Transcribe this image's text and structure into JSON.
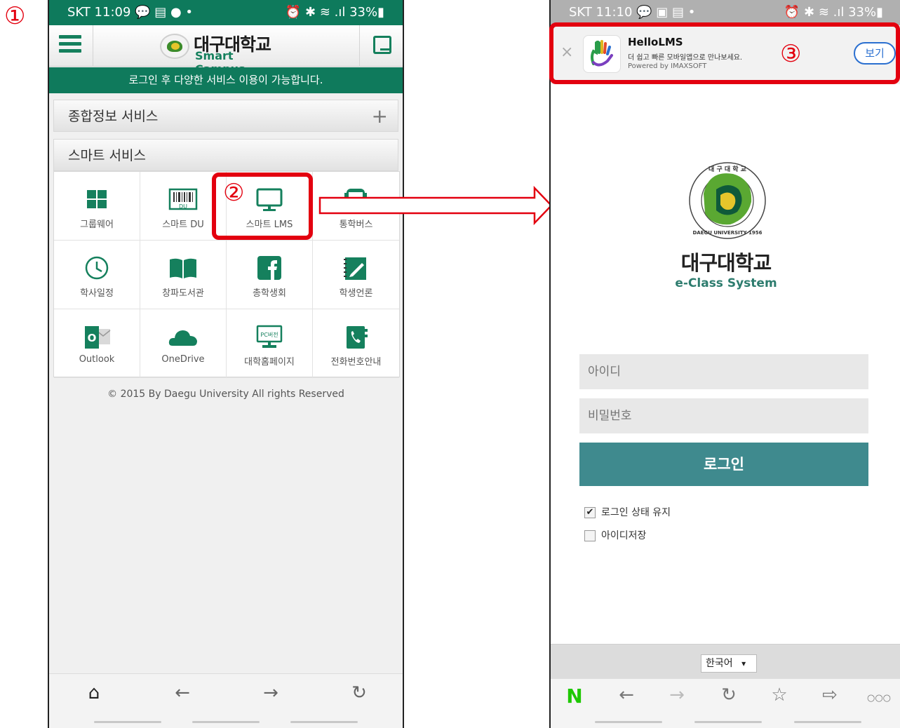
{
  "annotations": {
    "n1": "①",
    "n2": "②",
    "n3": "③"
  },
  "phone1": {
    "status": {
      "left": "SKT 11:09 💬 ▤ ● •",
      "right": "⏰ ✱ ≋ .ıl 33%▮"
    },
    "header": {
      "logo_ko": "대구대학교",
      "logo_en": "Smart Campus"
    },
    "banner": "로그인 후 다양한 서비스 이용이 가능합니다.",
    "section1": "종합정보 서비스",
    "section1_plus": "+",
    "section2": "스마트 서비스",
    "grid": [
      {
        "label": "그룹웨어",
        "icon": "groupware-icon"
      },
      {
        "label": "스마트 DU",
        "icon": "barcode-icon"
      },
      {
        "label": "스마트 LMS",
        "icon": "monitor-icon"
      },
      {
        "label": "통학버스",
        "icon": "bus-icon"
      },
      {
        "label": "학사일정",
        "icon": "clock-icon"
      },
      {
        "label": "창파도서관",
        "icon": "book-icon"
      },
      {
        "label": "총학생회",
        "icon": "facebook-icon"
      },
      {
        "label": "학생언론",
        "icon": "pen-icon"
      },
      {
        "label": "Outlook",
        "icon": "outlook-icon"
      },
      {
        "label": "OneDrive",
        "icon": "cloud-icon"
      },
      {
        "label": "대학홈페이지",
        "icon": "pc-version-icon"
      },
      {
        "label": "전화번호안내",
        "icon": "phone-book-icon"
      }
    ],
    "barcode_text": "DU",
    "pc_text": "PC버전",
    "outlook_text": "O",
    "copyright": "© 2015 By Daegu University All rights Reserved",
    "nav": {
      "home": "⌂",
      "back": "←",
      "forward": "→",
      "refresh": "↻"
    }
  },
  "phone2": {
    "status": {
      "left": "SKT 11:10 💬 ▣ ▤ •",
      "right": "⏰ ✱ ≋ .ıl 33%▮"
    },
    "ad": {
      "close": "×",
      "title": "HelloLMS",
      "desc": "더 쉽고 빠른 모바일앱으로 만나보세요.",
      "powered": "Powered by IMAXSOFT",
      "button": "보기"
    },
    "logo_ko": "대구대학교",
    "logo_en": "e-Class System",
    "emblem_text": "DAEGU UNIVERSITY 1956",
    "emblem_top": "대 구 대 학 교",
    "id_placeholder": "아이디",
    "pw_placeholder": "비밀번호",
    "login_button": "로그인",
    "keep_login": "로그인 상태 유지",
    "keep_login_checked": true,
    "save_id": "아이디저장",
    "check_mark": "✔",
    "language": "한국어",
    "language_arrow": "▾",
    "nav": {
      "naver": "N",
      "back": "←",
      "forward": "→",
      "refresh": "↻",
      "bookmark": "☆",
      "share": "⇨",
      "more": "○○○"
    }
  },
  "colors": {
    "green": "#0f7a5c",
    "teal_button": "#3f8a8e",
    "red_annotation": "#e3000f"
  }
}
